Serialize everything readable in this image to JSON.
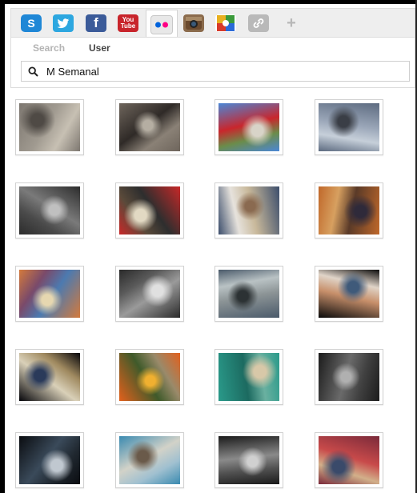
{
  "toolbar": {
    "tabs": [
      {
        "name": "skype",
        "icon": "skype-icon",
        "glyph": "S"
      },
      {
        "name": "twitter",
        "icon": "twitter-bird-icon",
        "glyph": "t"
      },
      {
        "name": "facebook",
        "icon": "facebook-icon",
        "glyph": "f"
      },
      {
        "name": "youtube",
        "icon": "youtube-icon",
        "glyph_top": "You",
        "glyph_bottom": "Tube"
      },
      {
        "name": "flickr",
        "icon": "flickr-icon",
        "active": true
      },
      {
        "name": "instagram",
        "icon": "instagram-camera-icon"
      },
      {
        "name": "picasa",
        "icon": "picasa-icon"
      },
      {
        "name": "link",
        "icon": "link-chain-icon"
      }
    ],
    "add_glyph": "+"
  },
  "search_panel": {
    "tabs": [
      "Search",
      "User"
    ],
    "active_tab": "User",
    "query": "M Semanal"
  },
  "photos": [
    {
      "label": "scene with debris on street",
      "palette": [
        "#7d7770",
        "#a09a90",
        "#4f4a45",
        "#c7c0b3"
      ]
    },
    {
      "label": "doorway of a building",
      "palette": [
        "#6e655c",
        "#2f2a27",
        "#b5aea2",
        "#8a8176"
      ]
    },
    {
      "label": "red sculpture under blue sky",
      "palette": [
        "#4b87d6",
        "#c9262c",
        "#d8d4c8",
        "#6b8c4a"
      ]
    },
    {
      "label": "dancer on city street",
      "palette": [
        "#5d6b80",
        "#9aa6b8",
        "#3a3e46",
        "#c6cfd9"
      ]
    },
    {
      "label": "man with camera",
      "palette": [
        "#2c2c2c",
        "#7a7a7a",
        "#c0c0c0",
        "#4b4b4b"
      ]
    },
    {
      "label": "ceremony with guards",
      "palette": [
        "#c72828",
        "#2e2e2e",
        "#e2d9c3",
        "#5a4a3a"
      ]
    },
    {
      "label": "crowd with signs",
      "palette": [
        "#3c4e6c",
        "#c8b89a",
        "#8a6a50",
        "#e6e2dc"
      ]
    },
    {
      "label": "street parade",
      "palette": [
        "#c0682a",
        "#5a3a28",
        "#2f2a3a",
        "#d7a060"
      ]
    },
    {
      "label": "colorful painting",
      "palette": [
        "#d47a3c",
        "#4c7ab0",
        "#e6d7b0",
        "#7a4a6a"
      ]
    },
    {
      "label": "shirtless man portrait",
      "palette": [
        "#2a2a2a",
        "#9a9a9a",
        "#e0e0e0",
        "#5a5a5a"
      ]
    },
    {
      "label": "man near truck",
      "palette": [
        "#4a5a6a",
        "#8c9496",
        "#2c3234",
        "#b9c2c4"
      ]
    },
    {
      "label": "child in fisheye view",
      "palette": [
        "#0b0b0b",
        "#c78f6a",
        "#3f5a7a",
        "#e0d4c8"
      ]
    },
    {
      "label": "opera house at night",
      "palette": [
        "#05050a",
        "#d9d0b8",
        "#2a3a5a",
        "#a08a60"
      ]
    },
    {
      "label": "fire and trees",
      "palette": [
        "#e2601c",
        "#3f5a2a",
        "#f0b030",
        "#9a8a6a"
      ]
    },
    {
      "label": "woman in teal room",
      "palette": [
        "#2a9a8a",
        "#1c6a60",
        "#d8c8a8",
        "#6ab0a0"
      ]
    },
    {
      "label": "elderly man face",
      "palette": [
        "#1c1c1c",
        "#6a6a6a",
        "#b0b0b0",
        "#404040"
      ]
    },
    {
      "label": "night street scene",
      "palette": [
        "#0a0c10",
        "#3a4a5a",
        "#c0c8d0",
        "#202830"
      ]
    },
    {
      "label": "bus in street",
      "palette": [
        "#3a8ab0",
        "#d2d2c8",
        "#6a5a4a",
        "#a0c0d0"
      ]
    },
    {
      "label": "man close-up face",
      "palette": [
        "#1a1a1a",
        "#8a8a8a",
        "#d0d0d0",
        "#505050"
      ]
    },
    {
      "label": "people in market",
      "palette": [
        "#7a2a3a",
        "#c84a4a",
        "#3a4a6a",
        "#d2b08a"
      ]
    }
  ]
}
